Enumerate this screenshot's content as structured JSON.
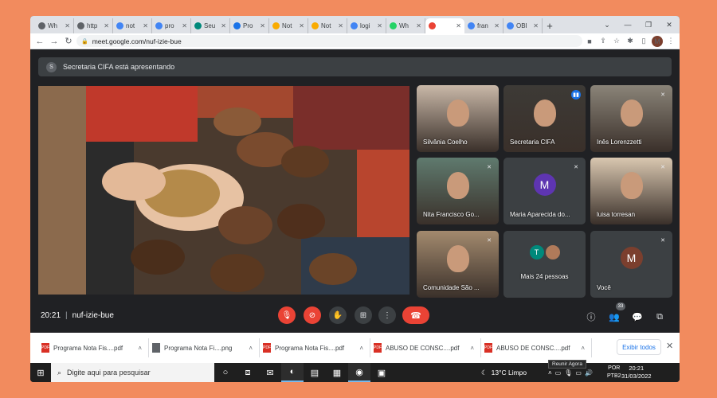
{
  "tabs": [
    {
      "label": "Wh",
      "color": "#5f6368"
    },
    {
      "label": "http",
      "color": "#5f6368"
    },
    {
      "label": "not",
      "color": "#4285f4"
    },
    {
      "label": "pro",
      "color": "#4285f4"
    },
    {
      "label": "Seu",
      "color": "#00897b"
    },
    {
      "label": "Pro",
      "color": "#1a73e8"
    },
    {
      "label": "Not",
      "color": "#f9ab00"
    },
    {
      "label": "Not",
      "color": "#f9ab00"
    },
    {
      "label": "logi",
      "color": "#4285f4"
    },
    {
      "label": "Wh",
      "color": "#25d366"
    },
    {
      "label": "",
      "color": "#ea4335",
      "active": true
    },
    {
      "label": "fran",
      "color": "#4285f4"
    },
    {
      "label": "OBI",
      "color": "#4285f4"
    }
  ],
  "address": {
    "url": "meet.google.com/nuf-izie-bue"
  },
  "profile_initial": "M",
  "banner": {
    "avatar": "S",
    "text": "Secretaria CIFA está apresentando"
  },
  "participants": [
    {
      "name": "Silvânia Coelho",
      "kind": "video",
      "bg": "#c9b8a8",
      "mic": "none"
    },
    {
      "name": "Secretaria CIFA",
      "kind": "video",
      "bg": "#3d3a36",
      "mic": "speaking"
    },
    {
      "name": "Inês Lorenzzetti",
      "kind": "video",
      "bg": "#8a8478",
      "mic": "muted"
    },
    {
      "name": "Nita Francisco Go...",
      "kind": "video",
      "bg": "#5f7a6e",
      "mic": "muted"
    },
    {
      "name": "Maria Aparecida do...",
      "kind": "avatar",
      "initial": "M",
      "avatar_color": "#5e35b1",
      "mic": "muted"
    },
    {
      "name": "luisa torresan",
      "kind": "video",
      "bg": "#d9c7b0",
      "mic": "muted"
    },
    {
      "name": "Comunidade São ...",
      "kind": "video",
      "bg": "#a38a6e",
      "mic": "muted"
    },
    {
      "name": "Mais 24 pessoas",
      "kind": "more",
      "initials": [
        "T",
        ""
      ],
      "mic": "none"
    },
    {
      "name": "Você",
      "kind": "avatar",
      "initial": "M",
      "avatar_color": "#7b3f2e",
      "mic": "muted"
    }
  ],
  "meeting": {
    "time": "20:21",
    "code": "nuf-izie-bue",
    "participant_count": "33"
  },
  "downloads": [
    {
      "name": "Programa Nota Fis....pdf",
      "type": "pdf"
    },
    {
      "name": "Programa Nota Fi....png",
      "type": "png"
    },
    {
      "name": "Programa Nota Fis....pdf",
      "type": "pdf"
    },
    {
      "name": "ABUSO DE CONSC....pdf",
      "type": "pdf"
    },
    {
      "name": "ABUSO DE CONSC....pdf",
      "type": "pdf"
    }
  ],
  "show_all_label": "Exibir todos",
  "taskbar": {
    "search_placeholder": "Digite aqui para pesquisar",
    "weather": "13°C  Limpo",
    "lang_top": "POR",
    "lang_bottom": "PTB2",
    "time": "20:21",
    "date": "31/03/2022",
    "tooltip": "Reunir Agora"
  }
}
